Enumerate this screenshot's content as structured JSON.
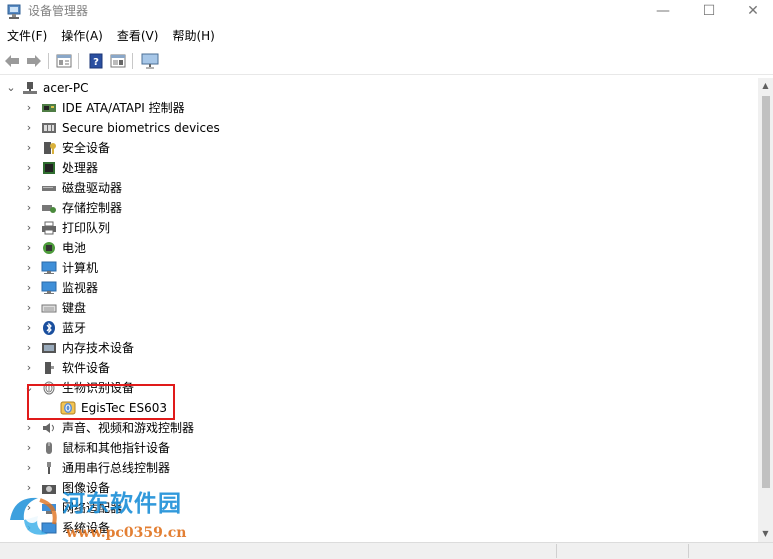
{
  "window": {
    "title": "设备管理器",
    "minimize_glyph": "—",
    "maximize_glyph": "☐",
    "close_glyph": "✕"
  },
  "menu": [
    {
      "label": "文件(F)"
    },
    {
      "label": "操作(A)"
    },
    {
      "label": "查看(V)"
    },
    {
      "label": "帮助(H)"
    }
  ],
  "toolbar": {
    "icons": [
      "back-arrow-icon",
      "forward-arrow-icon",
      "properties-icon",
      "help-icon",
      "show-hide-icon",
      "monitor-icon"
    ]
  },
  "tree": {
    "root": {
      "label": "acer-PC",
      "expanded": true,
      "icon": "computer-icon"
    },
    "items": [
      {
        "label": "IDE ATA/ATAPI 控制器",
        "icon": "ide-controller-icon",
        "expanded": false
      },
      {
        "label": "Secure biometrics devices",
        "icon": "biometrics-device-icon",
        "expanded": false
      },
      {
        "label": "安全设备",
        "icon": "security-device-icon",
        "expanded": false
      },
      {
        "label": "处理器",
        "icon": "processor-icon",
        "expanded": false
      },
      {
        "label": "磁盘驱动器",
        "icon": "disk-drive-icon",
        "expanded": false
      },
      {
        "label": "存储控制器",
        "icon": "storage-controller-icon",
        "expanded": false
      },
      {
        "label": "打印队列",
        "icon": "printer-icon",
        "expanded": false
      },
      {
        "label": "电池",
        "icon": "battery-icon",
        "expanded": false
      },
      {
        "label": "计算机",
        "icon": "computer-icon",
        "expanded": false
      },
      {
        "label": "监视器",
        "icon": "monitor-icon",
        "expanded": false
      },
      {
        "label": "键盘",
        "icon": "keyboard-icon",
        "expanded": false
      },
      {
        "label": "蓝牙",
        "icon": "bluetooth-icon",
        "expanded": false
      },
      {
        "label": "内存技术设备",
        "icon": "memory-device-icon",
        "expanded": false
      },
      {
        "label": "软件设备",
        "icon": "software-device-icon",
        "expanded": false
      },
      {
        "label": "生物识别设备",
        "icon": "fingerprint-icon",
        "expanded": true,
        "children": [
          {
            "label": "EgisTec ES603",
            "icon": "fingerprint-reader-icon"
          }
        ]
      },
      {
        "label": "声音、视频和游戏控制器",
        "icon": "sound-icon",
        "expanded": false
      },
      {
        "label": "鼠标和其他指针设备",
        "icon": "mouse-icon",
        "expanded": false
      },
      {
        "label": "通用串行总线控制器",
        "icon": "usb-icon",
        "expanded": false
      },
      {
        "label": "图像设备",
        "icon": "camera-icon",
        "expanded": false
      },
      {
        "label": "网络适配器",
        "icon": "network-adapter-icon",
        "expanded": false
      },
      {
        "label": "系统设备",
        "icon": "system-device-icon",
        "expanded": false
      }
    ]
  },
  "annotation": {
    "color": "#e01a1a"
  },
  "watermark": {
    "name": "河东软件园",
    "url": "www.pc0359.cn"
  },
  "colors": {
    "accent": "#1b8fd8",
    "watermark_url": "#e0721e"
  }
}
